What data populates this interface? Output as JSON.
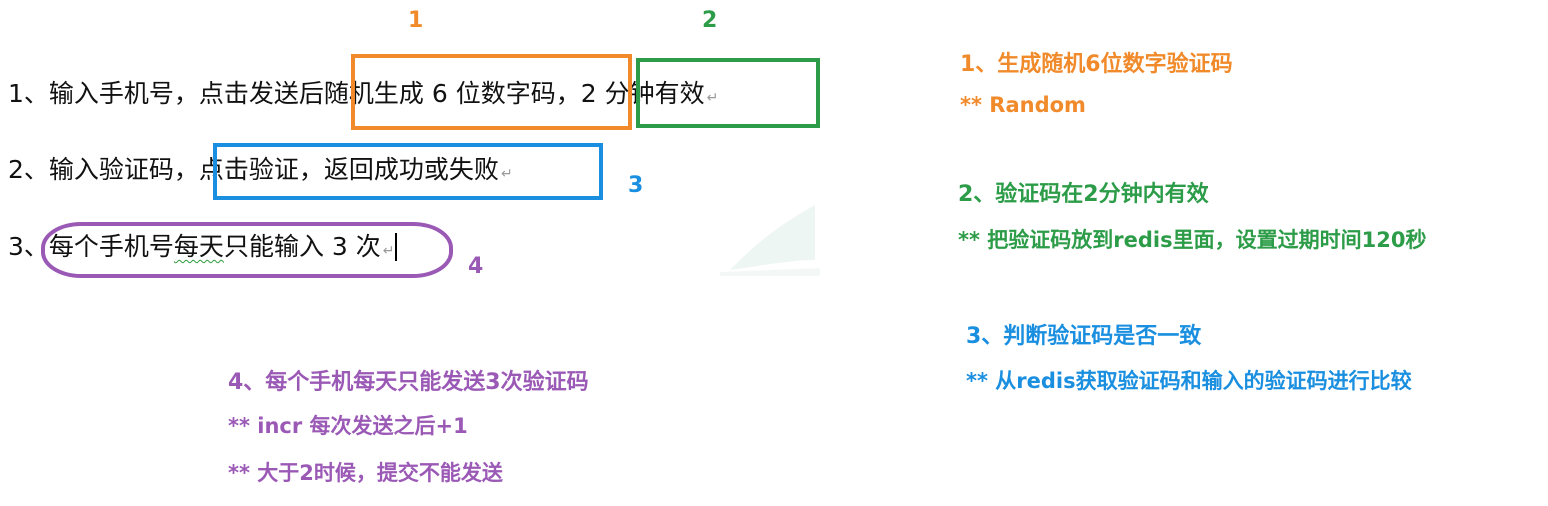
{
  "doc": {
    "line1_a": "1、输入手机号，点击发送后",
    "line1_b": "随机生成 6 位数字码",
    "line1_c": "，",
    "line1_d": "2 分钟有效",
    "line2_a": "2、输入验证码，",
    "line2_b": "点击验证，返回成功或失败",
    "line3_a": "3、",
    "line3_b": "每个手机号",
    "line3_c": "每天",
    "line3_d": "只能输入 3 次",
    "return_mark": "↵"
  },
  "markers": {
    "m1": "1",
    "m2": "2",
    "m3": "3",
    "m4": "4"
  },
  "notes": {
    "n1_title": "1、生成随机6位数字验证码",
    "n1_sub": "** Random",
    "n2_title": "2、验证码在2分钟内有效",
    "n2_sub": "** 把验证码放到redis里面，设置过期时间120秒",
    "n3_title": "3、判断验证码是否一致",
    "n3_sub": "** 从redis获取验证码和输入的验证码进行比较",
    "n4_title": "4、每个手机每天只能发送3次验证码",
    "n4_sub1": "** incr 每次发送之后+1",
    "n4_sub2": "** 大于2时候，提交不能发送"
  },
  "colors": {
    "orange": "#f08a2a",
    "green": "#2c9c48",
    "blue": "#1a8fe0",
    "purple": "#9b59b6"
  }
}
